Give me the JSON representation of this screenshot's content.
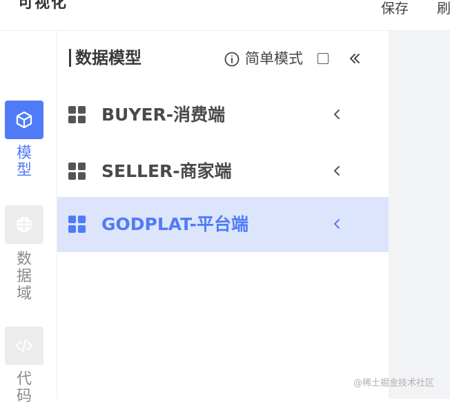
{
  "topbar": {
    "logo_text": "可视化",
    "save_label": "保存",
    "refresh_label": "刷"
  },
  "rail": {
    "items": [
      {
        "label": "模型",
        "icon": "cube-icon",
        "active": true
      },
      {
        "label": "数据域",
        "icon": "globe-icon",
        "active": false
      },
      {
        "label": "代码",
        "icon": "code-icon",
        "active": false
      }
    ]
  },
  "panel": {
    "title": "数据模型",
    "simple_mode_label": "简单模式",
    "simple_mode_checked": false,
    "items": [
      {
        "label": "BUYER-消费端",
        "icon": "grid-icon",
        "selected": false
      },
      {
        "label": "SELLER-商家端",
        "icon": "grid-icon",
        "selected": false
      },
      {
        "label": "GODPLAT-平台端",
        "icon": "grid-icon",
        "selected": true
      }
    ]
  },
  "watermark": "@稀土掘金技术社区",
  "colors": {
    "accent": "#4f7cf6",
    "selected_bg": "#dde5fd",
    "content_bg": "#f2f3f5"
  }
}
